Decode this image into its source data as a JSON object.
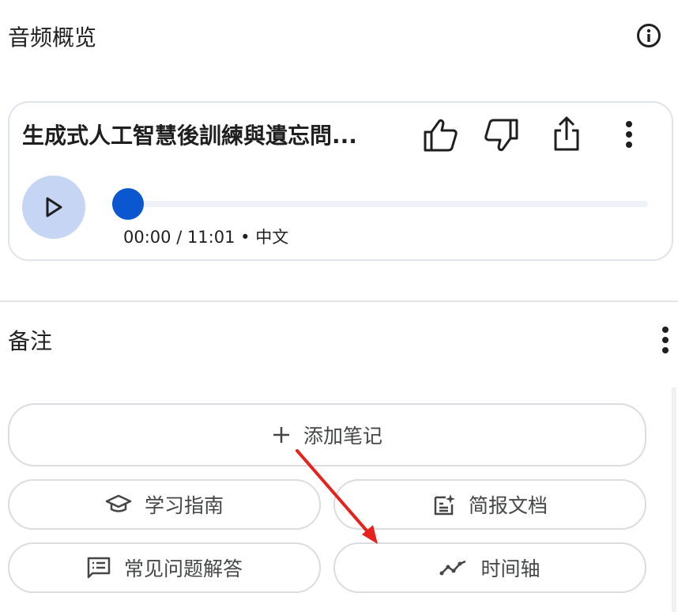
{
  "audio_overview": {
    "section_title": "音频概览",
    "info_icon": "info-icon",
    "card": {
      "title": "生成式人工智慧後訓練與遺忘問...",
      "time": "00:00 / 11:01",
      "separator": "•",
      "language": "中文",
      "progress_fraction": 0.0,
      "icons": [
        "thumb-up-icon",
        "thumb-down-icon",
        "share-icon",
        "more-vert-icon",
        "play-icon"
      ]
    }
  },
  "notes": {
    "section_title": "备注",
    "more_icon": "more-vert-icon",
    "add_note": {
      "icon": "plus-icon",
      "label": "添加笔记"
    },
    "actions": [
      {
        "icon": "school-cap-icon",
        "label": "学习指南"
      },
      {
        "icon": "document-sparkle-icon",
        "label": "简报文档"
      },
      {
        "icon": "faq-list-icon",
        "label": "常见问题解答"
      },
      {
        "icon": "timeline-icon",
        "label": "时间轴"
      }
    ]
  },
  "colors": {
    "accent_blue": "#0b57d0",
    "play_button_bg": "#c5d5f3",
    "annotation_arrow": "#e5221c"
  }
}
